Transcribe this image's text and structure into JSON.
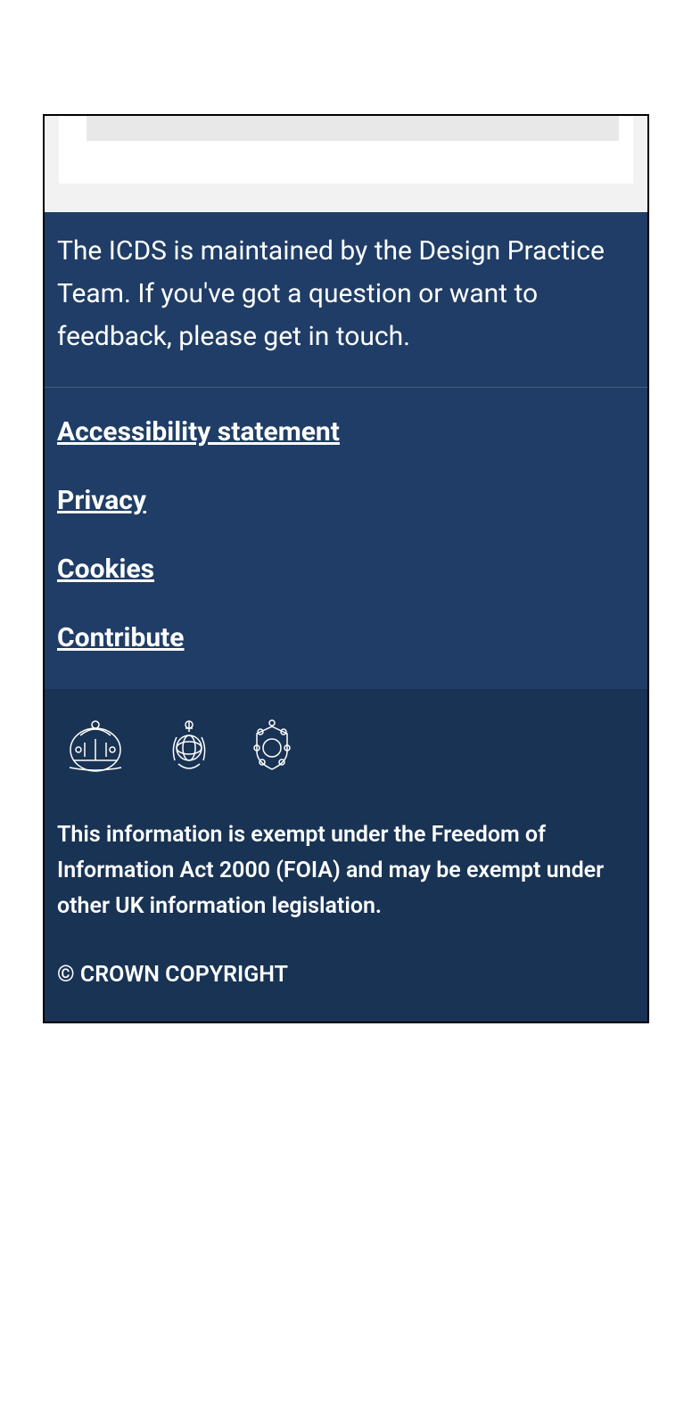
{
  "footer": {
    "intro": "The ICDS is maintained by the Design Practice Team. If you've got a question or want to feedback, please get in touch.",
    "links": {
      "accessibility": "Accessibility statement",
      "privacy": "Privacy",
      "cookies": "Cookies",
      "contribute": "Contribute"
    },
    "exempt": "This information is exempt under the Freedom of Information Act 2000 (FOIA) and may be exempt under other UK information legislation.",
    "copyright": "© CROWN COPYRIGHT"
  }
}
